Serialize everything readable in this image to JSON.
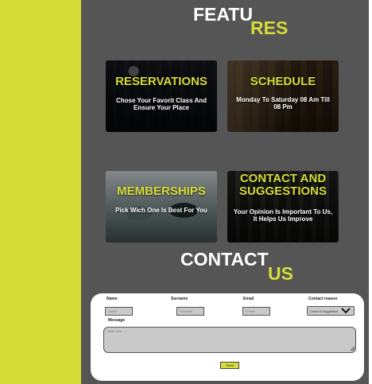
{
  "features": {
    "heading_part1": "FEATU",
    "heading_part2": "RES"
  },
  "cards": [
    {
      "title": "RESERVATIONS",
      "desc": "Chose Your Favorit Class And Ensure Your Place"
    },
    {
      "title": "SCHEDULE",
      "desc": "Monday To Saturday 08 Am Till 08 Pm"
    },
    {
      "title": "MEMBERSHIPS",
      "desc": "Pick Wich One Is Best For You"
    },
    {
      "title": "CONTACT AND SUGGESTIONS",
      "desc": "Your Opinion Is Important To Us, It Helps Us Improve"
    }
  ],
  "contact": {
    "heading_part1": "CONTACT",
    "heading_part2": "US",
    "form": {
      "name_label": "Name",
      "name_placeholder": "Name",
      "surname_label": "Surname",
      "surname_placeholder": "Surname",
      "email_label": "Email",
      "email_placeholder": "E-mail",
      "reason_label": "Contact reason",
      "reason_value": "Leave A Suggestion",
      "message_label": "Message",
      "message_placeholder": "Write here...",
      "send_label": "Send"
    }
  },
  "colors": {
    "accent": "#d4dc35",
    "background": "#555555",
    "panel": "#ffffff"
  },
  "icons": {
    "select_arrow": "chevron-down-icon",
    "textarea_grip": "resize-grip-icon"
  }
}
